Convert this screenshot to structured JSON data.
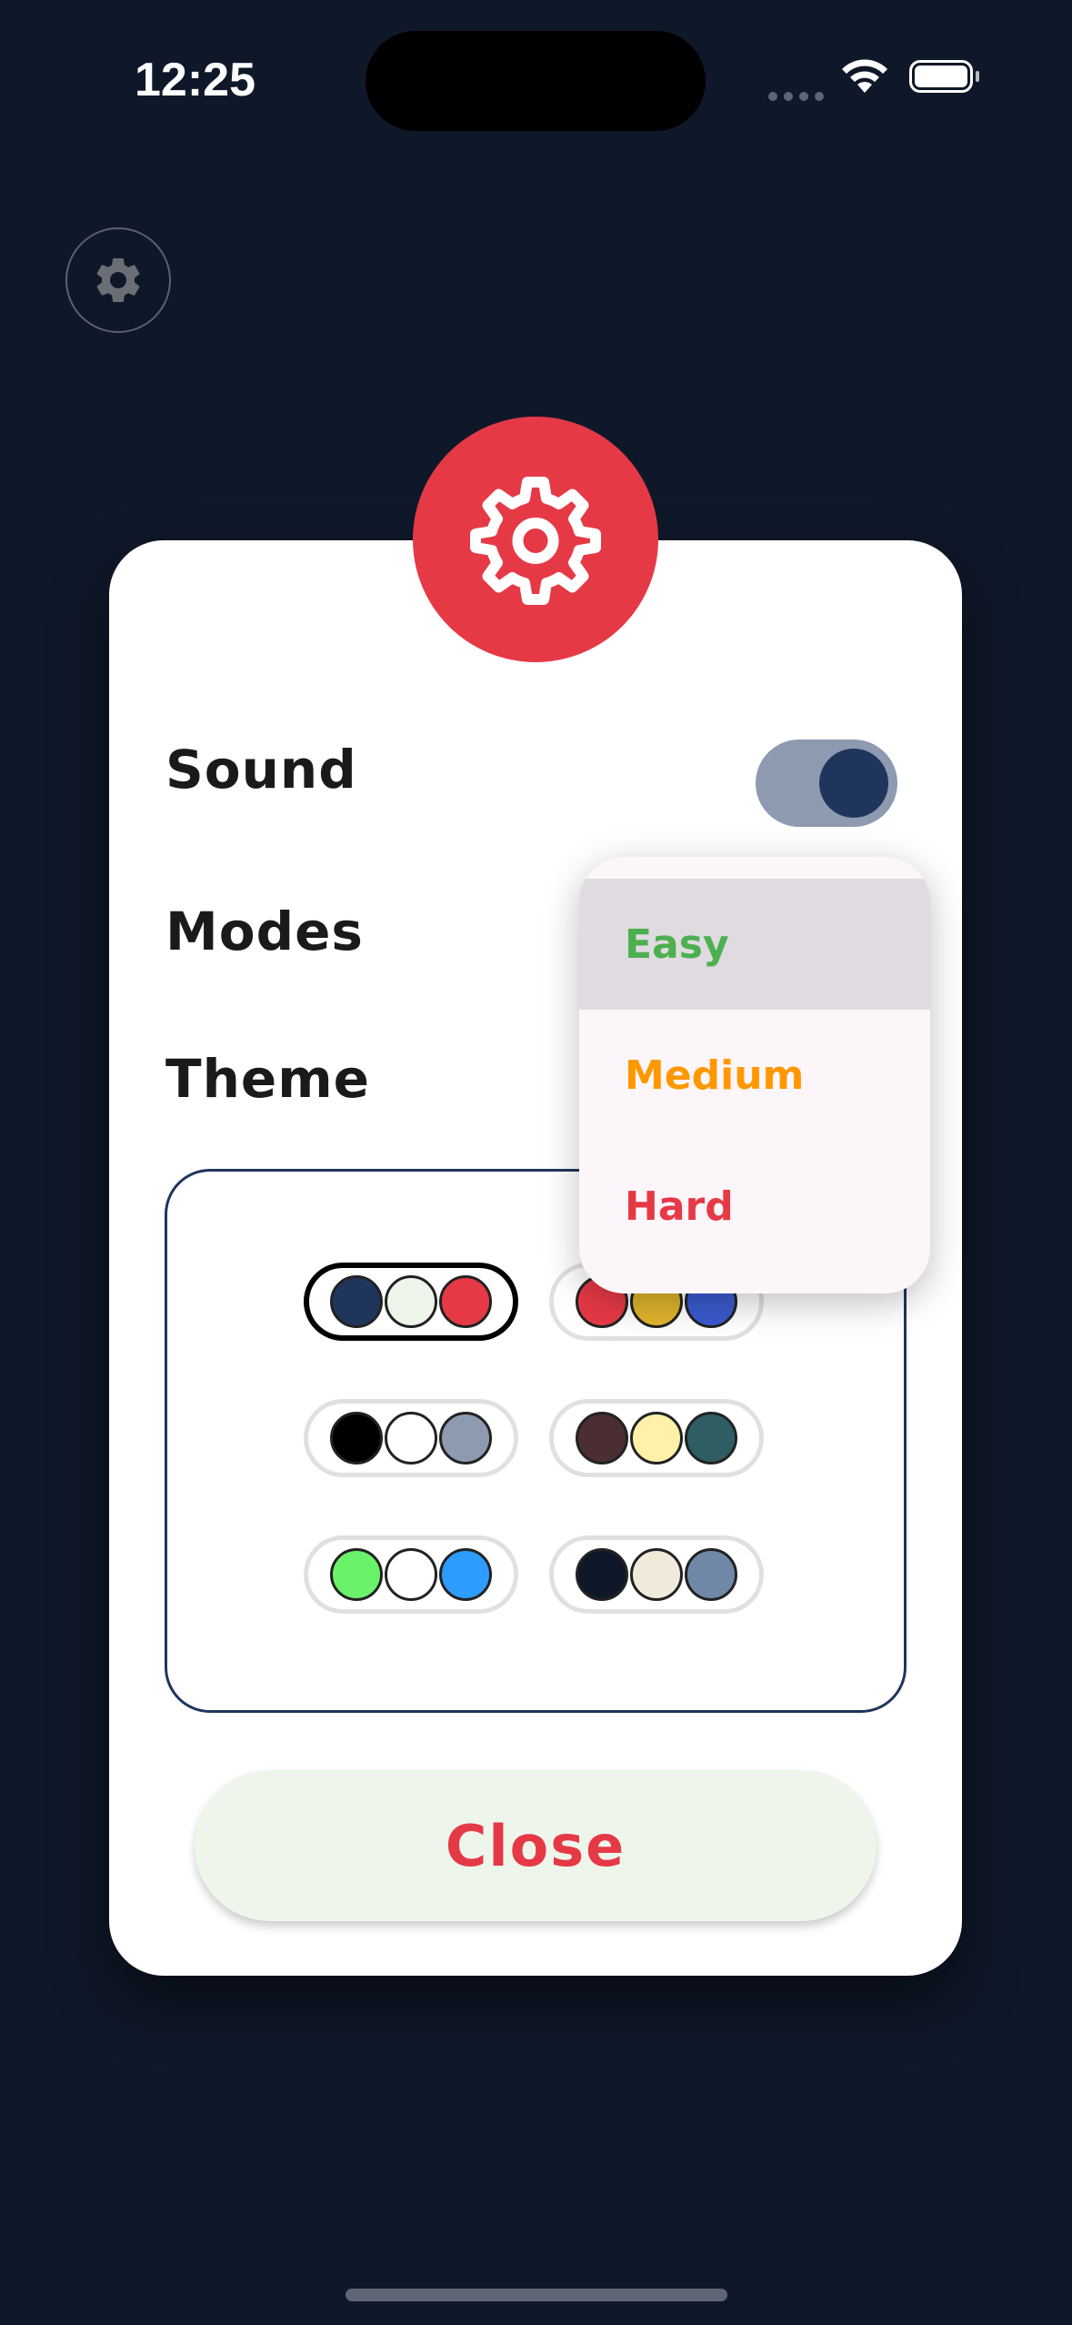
{
  "status_bar": {
    "time": "12:25"
  },
  "settings": {
    "sound_label": "Sound",
    "sound_enabled": true,
    "modes_label": "Modes",
    "theme_label": "Theme",
    "close_label": "Close"
  },
  "modes_dropdown": {
    "options": [
      {
        "label": "Easy",
        "color": "#4CAF50",
        "selected": true
      },
      {
        "label": "Medium",
        "color": "#FF9800",
        "selected": false
      },
      {
        "label": "Hard",
        "color": "#E63946",
        "selected": false
      }
    ]
  },
  "themes": [
    {
      "colors": [
        "#1F355C",
        "#EEF6EC",
        "#E63946"
      ],
      "selected": true
    },
    {
      "colors": [
        "#E63946",
        "#E0B52C",
        "#3A5BD0"
      ],
      "selected": false
    },
    {
      "colors": [
        "#000000",
        "#FFFFFF",
        "#8E9AB0"
      ],
      "selected": false
    },
    {
      "colors": [
        "#4A2E31",
        "#FFF1A8",
        "#2E5E63"
      ],
      "selected": false
    },
    {
      "colors": [
        "#6BF26B",
        "#FFFFFF",
        "#2E9BFF"
      ],
      "selected": false
    },
    {
      "colors": [
        "#0F1829",
        "#F0EADB",
        "#7088A8"
      ],
      "selected": false
    }
  ],
  "colors": {
    "background": "#0F1829",
    "accent": "#E63946",
    "primary": "#1F355C"
  }
}
